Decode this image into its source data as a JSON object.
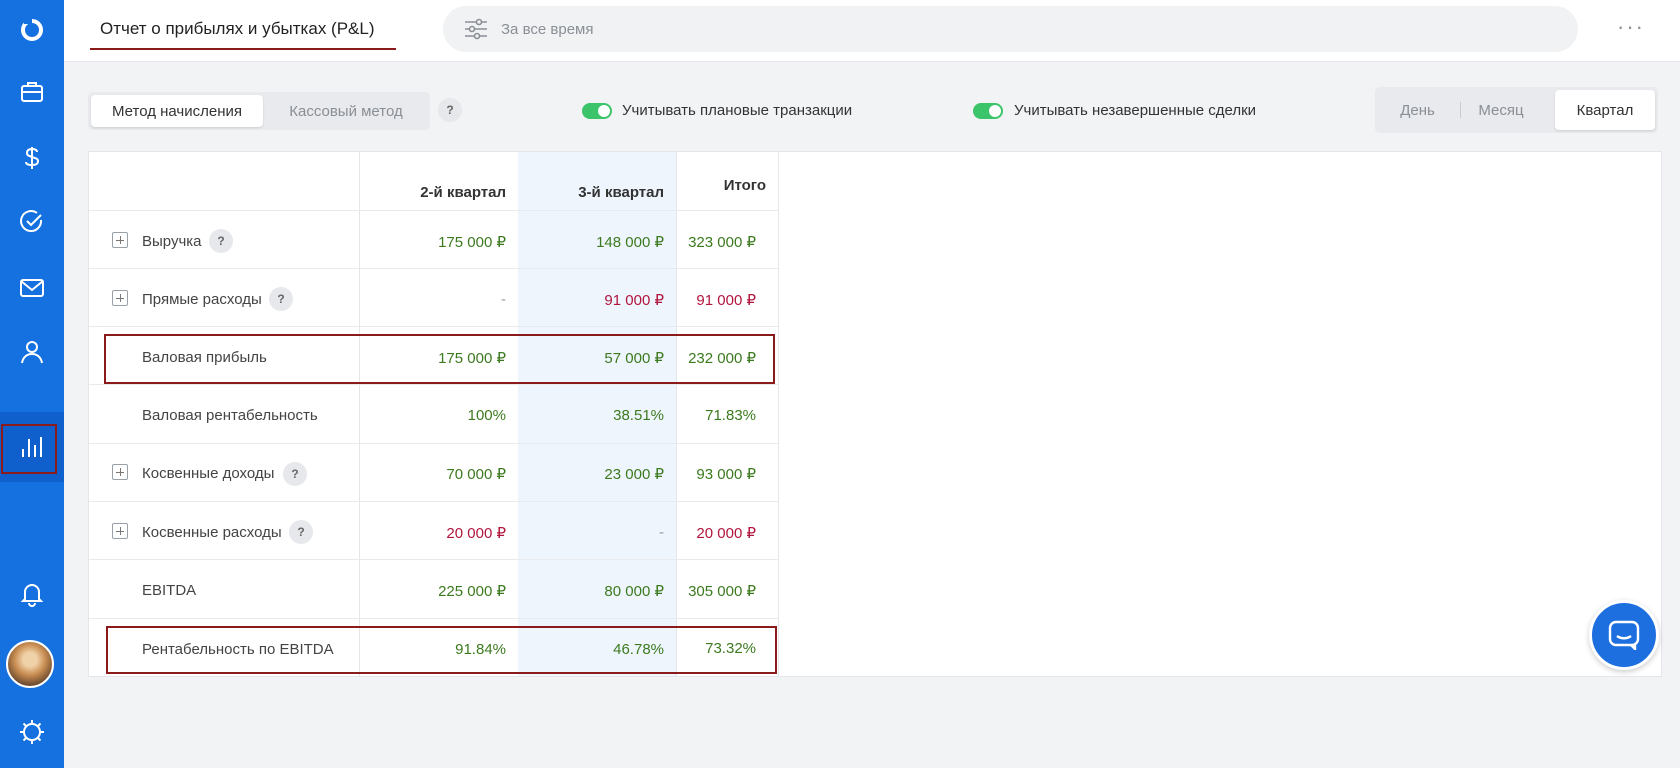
{
  "app": {
    "title": "Отчет о прибылях и убытках (P&L)",
    "accent": "#1570e0"
  },
  "sidebar": {
    "items": [
      {
        "name": "logo-icon"
      },
      {
        "name": "briefcase-icon"
      },
      {
        "name": "dollar-icon"
      },
      {
        "name": "check-circle-icon"
      },
      {
        "name": "mail-icon"
      },
      {
        "name": "user-icon"
      },
      {
        "name": "bar-chart-icon",
        "active": true
      },
      {
        "name": "bell-icon"
      },
      {
        "name": "settings-icon"
      }
    ]
  },
  "filter": {
    "label": "За все время",
    "icon": "sliders-icon"
  },
  "controls": {
    "method": {
      "options": [
        "Метод начисления",
        "Кассовый метод"
      ],
      "selected": "Метод начисления",
      "help": "?"
    },
    "toggle_planned": {
      "label": "Учитывать плановые транзакции",
      "on": true
    },
    "toggle_deals": {
      "label": "Учитывать незавершенные сделки",
      "on": true
    },
    "period": {
      "options": [
        "День",
        "Месяц",
        "Квартал"
      ],
      "selected": "Квартал"
    }
  },
  "table": {
    "columns": [
      "2-й квартал",
      "3-й квартал",
      "Итого"
    ],
    "rows": [
      {
        "label": "Выручка",
        "expandable": true,
        "help": "?",
        "values": [
          "175 000 ₽",
          "148 000 ₽",
          "323 000 ₽"
        ],
        "tones": [
          "g",
          "g",
          "g"
        ]
      },
      {
        "label": "Прямые расходы",
        "expandable": true,
        "help": "?",
        "values": [
          "-",
          "91 000 ₽",
          "91 000 ₽"
        ],
        "tones": [
          "d",
          "r",
          "r"
        ]
      },
      {
        "label": "Валовая прибыль",
        "expandable": false,
        "values": [
          "175 000 ₽",
          "57 000 ₽",
          "232 000 ₽"
        ],
        "tones": [
          "g",
          "g",
          "g"
        ]
      },
      {
        "label": "Валовая рентабельность",
        "expandable": false,
        "values": [
          "100%",
          "38.51%",
          "71.83%"
        ],
        "tones": [
          "g",
          "g",
          "g"
        ]
      },
      {
        "label": "Косвенные доходы",
        "expandable": true,
        "help": "?",
        "values": [
          "70 000 ₽",
          "23 000 ₽",
          "93 000 ₽"
        ],
        "tones": [
          "g",
          "g",
          "g"
        ]
      },
      {
        "label": "Косвенные расходы",
        "expandable": true,
        "help": "?",
        "values": [
          "20 000 ₽",
          "-",
          "20 000 ₽"
        ],
        "tones": [
          "r",
          "d",
          "r"
        ]
      },
      {
        "label": "EBITDA",
        "expandable": false,
        "values": [
          "225 000 ₽",
          "80 000 ₽",
          "305 000 ₽"
        ],
        "tones": [
          "g",
          "g",
          "g"
        ]
      },
      {
        "label": "Рентабельность по EBITDA",
        "expandable": false,
        "values": [
          "91.84%",
          "46.78%",
          "73.32%"
        ],
        "tones": [
          "g",
          "g",
          "g"
        ]
      }
    ]
  },
  "chat": {
    "icon": "chat-icon"
  }
}
